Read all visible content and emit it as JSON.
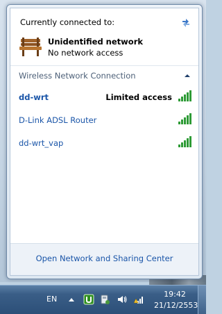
{
  "flyout": {
    "connected_header": "Currently connected to:",
    "current_network": {
      "name": "Unidentified network",
      "status": "No network access",
      "icon": "bench-icon"
    },
    "section": {
      "title": "Wireless Network Connection"
    },
    "networks": [
      {
        "name": "dd-wrt",
        "access": "Limited access",
        "signal": "full"
      },
      {
        "name": "D-Link ADSL Router",
        "access": "",
        "signal": "full"
      },
      {
        "name": "dd-wrt_vap",
        "access": "",
        "signal": "full"
      }
    ],
    "footer_link": "Open Network and Sharing Center"
  },
  "taskbar": {
    "language": "EN",
    "clock": {
      "time": "19:42",
      "date": "21/12/2553"
    }
  },
  "colors": {
    "link": "#1a55a8",
    "section_title": "#4d6078",
    "signal_green": "#2e9b36",
    "taskbar": "#2c4f78"
  }
}
